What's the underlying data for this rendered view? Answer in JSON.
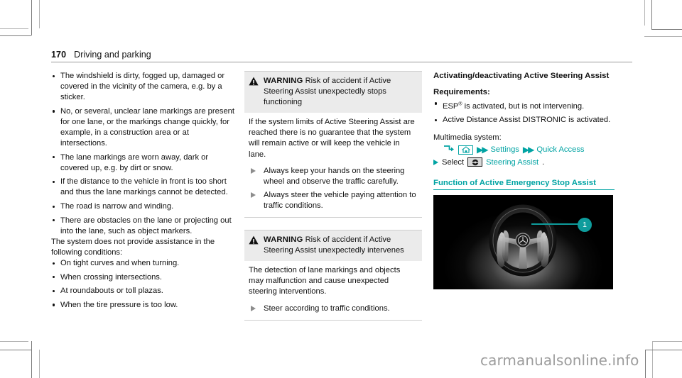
{
  "header": {
    "folio": "170",
    "chapter": "Driving and parking"
  },
  "left_column": {
    "limits_bullets": [
      "The windshield is dirty, fogged up, damaged or covered in the vicinity of the camera, e.g. by a sticker.",
      "No, or several, unclear lane markings are present for one lane, or the markings change quickly, for example, in a construction area or at intersections.",
      "The lane markings are worn away, dark or covered up, e.g. by dirt or snow.",
      "If the distance to the vehicle in front is too short and thus the lane markings cannot be detected.",
      "The road is narrow and winding.",
      "There are obstacles on the lane or projecting out into the lane, such as object markers."
    ],
    "no_assist_intro": "The system does not provide assistance in the following conditions:",
    "no_assist_bullets": [
      "On tight curves and when turning.",
      "When crossing intersections.",
      "At roundabouts or toll plazas.",
      "When the tire pressure is too low."
    ]
  },
  "warnings": [
    {
      "label": "WARNING",
      "title": "Risk of accident if Active Steering Assist unexpectedly stops functioning",
      "body": "If the system limits of Active Steering Assist are reached there is no guarantee that the system will remain active or will keep the vehicle in lane.",
      "steps": [
        "Always keep your hands on the steering wheel and observe the traffic carefully.",
        "Always steer the vehicle paying attention to traffic conditions."
      ]
    },
    {
      "label": "WARNING",
      "title": "Risk of accident if Active Steering Assist unexpectedly intervenes",
      "body": "The detection of lane markings and objects may malfunction and cause unexpected steering interventions.",
      "steps": [
        "Steer according to traffic conditions."
      ]
    }
  ],
  "right_column": {
    "heading": "Activating/deactivating Active Steering Assist",
    "requirements_label": "Requirements:",
    "requirements": [
      "ESP® is activated, but is not intervening.",
      "Active Distance Assist DISTRONIC is activated."
    ],
    "multimedia_label": "Multimedia system:",
    "nav_path": {
      "arrow_icon": "corner-arrow-icon",
      "home_icon": "home-icon",
      "chevron_1": "▶▶",
      "item_1": "Settings",
      "chevron_2": "▶▶",
      "item_2": "Quick Access"
    },
    "select_line": {
      "verb": "Select",
      "icon": "steering-wheel-icon",
      "target": "Steering Assist",
      "period": "."
    },
    "section_heading": "Function of Active Emergency Stop Assist",
    "figure": {
      "callout_number": "1",
      "alt": "steering wheel with hands illustration"
    }
  },
  "watermark": "carmanualsonline.info",
  "colors": {
    "teal": "#00a3a3",
    "warn_head_bg": "#ebebeb",
    "rule": "#9a9a9a"
  }
}
